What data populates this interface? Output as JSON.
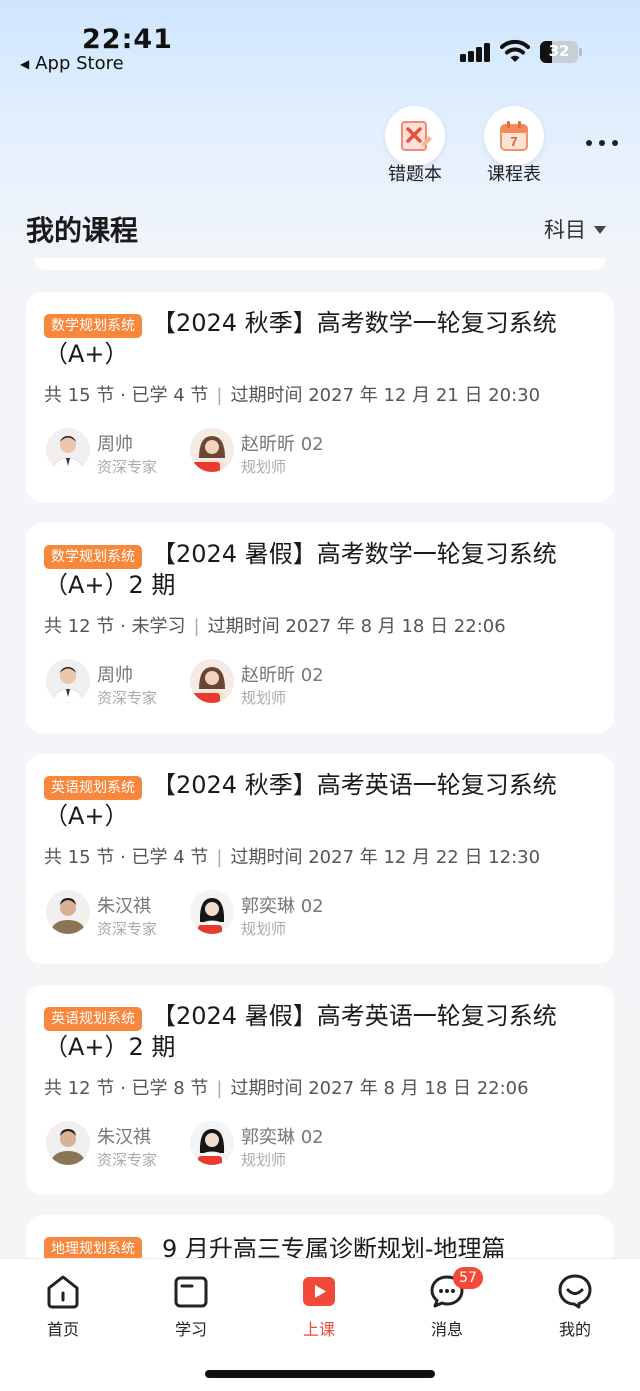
{
  "status_bar": {
    "time": "22:41",
    "back_label": "App Store",
    "battery": "32"
  },
  "header": {
    "tools": [
      {
        "label": "错题本",
        "icon": "wrong-questions-book-icon"
      },
      {
        "label": "课程表",
        "icon": "calendar-schedule-icon",
        "calendar_day": "7"
      }
    ],
    "more_icon": "more-dots-icon",
    "title": "我的课程",
    "filter_label": "科目"
  },
  "courses": [
    {
      "tag": "数学规划系统",
      "title": "【2024 秋季】高考数学一轮复习系统（A+）",
      "lessons": "共 15 节 · 已学 4 节",
      "expiry": "过期时间 2027 年 12 月 21 日 20:30",
      "teacher": {
        "name": "周帅",
        "role": "资深专家"
      },
      "planner": {
        "name": "赵昕昕 02",
        "role": "规划师"
      }
    },
    {
      "tag": "数学规划系统",
      "title": "【2024 暑假】高考数学一轮复习系统（A+）2 期",
      "lessons": "共 12 节 · 未学习",
      "expiry": "过期时间 2027 年 8 月 18 日 22:06",
      "teacher": {
        "name": "周帅",
        "role": "资深专家"
      },
      "planner": {
        "name": "赵昕昕 02",
        "role": "规划师"
      }
    },
    {
      "tag": "英语规划系统",
      "title": "【2024 秋季】高考英语一轮复习系统（A+）",
      "lessons": "共 15 节 · 已学 4 节",
      "expiry": "过期时间 2027 年 12 月 22 日 12:30",
      "teacher": {
        "name": "朱汉祺",
        "role": "资深专家"
      },
      "planner": {
        "name": "郭奕琳 02",
        "role": "规划师"
      }
    },
    {
      "tag": "英语规划系统",
      "title": "【2024 暑假】高考英语一轮复习系统（A+）2 期",
      "lessons": "共 12 节 · 已学 8 节",
      "expiry": "过期时间 2027 年 8 月 18 日 22:06",
      "teacher": {
        "name": "朱汉祺",
        "role": "资深专家"
      },
      "planner": {
        "name": "郭奕琳 02",
        "role": "规划师"
      }
    },
    {
      "tag": "地理规划系统",
      "title": "9 月升高三专属诊断规划-地理篇"
    }
  ],
  "tabbar": [
    {
      "label": "首页",
      "icon": "home-icon"
    },
    {
      "label": "学习",
      "icon": "study-icon"
    },
    {
      "label": "上课",
      "icon": "play-class-icon",
      "active": true
    },
    {
      "label": "消息",
      "icon": "message-icon",
      "badge": "57"
    },
    {
      "label": "我的",
      "icon": "profile-icon"
    }
  ],
  "colors": {
    "tag_orange": "#f6873c",
    "active_red": "#f2493a",
    "badge_red": "#f4483a"
  }
}
